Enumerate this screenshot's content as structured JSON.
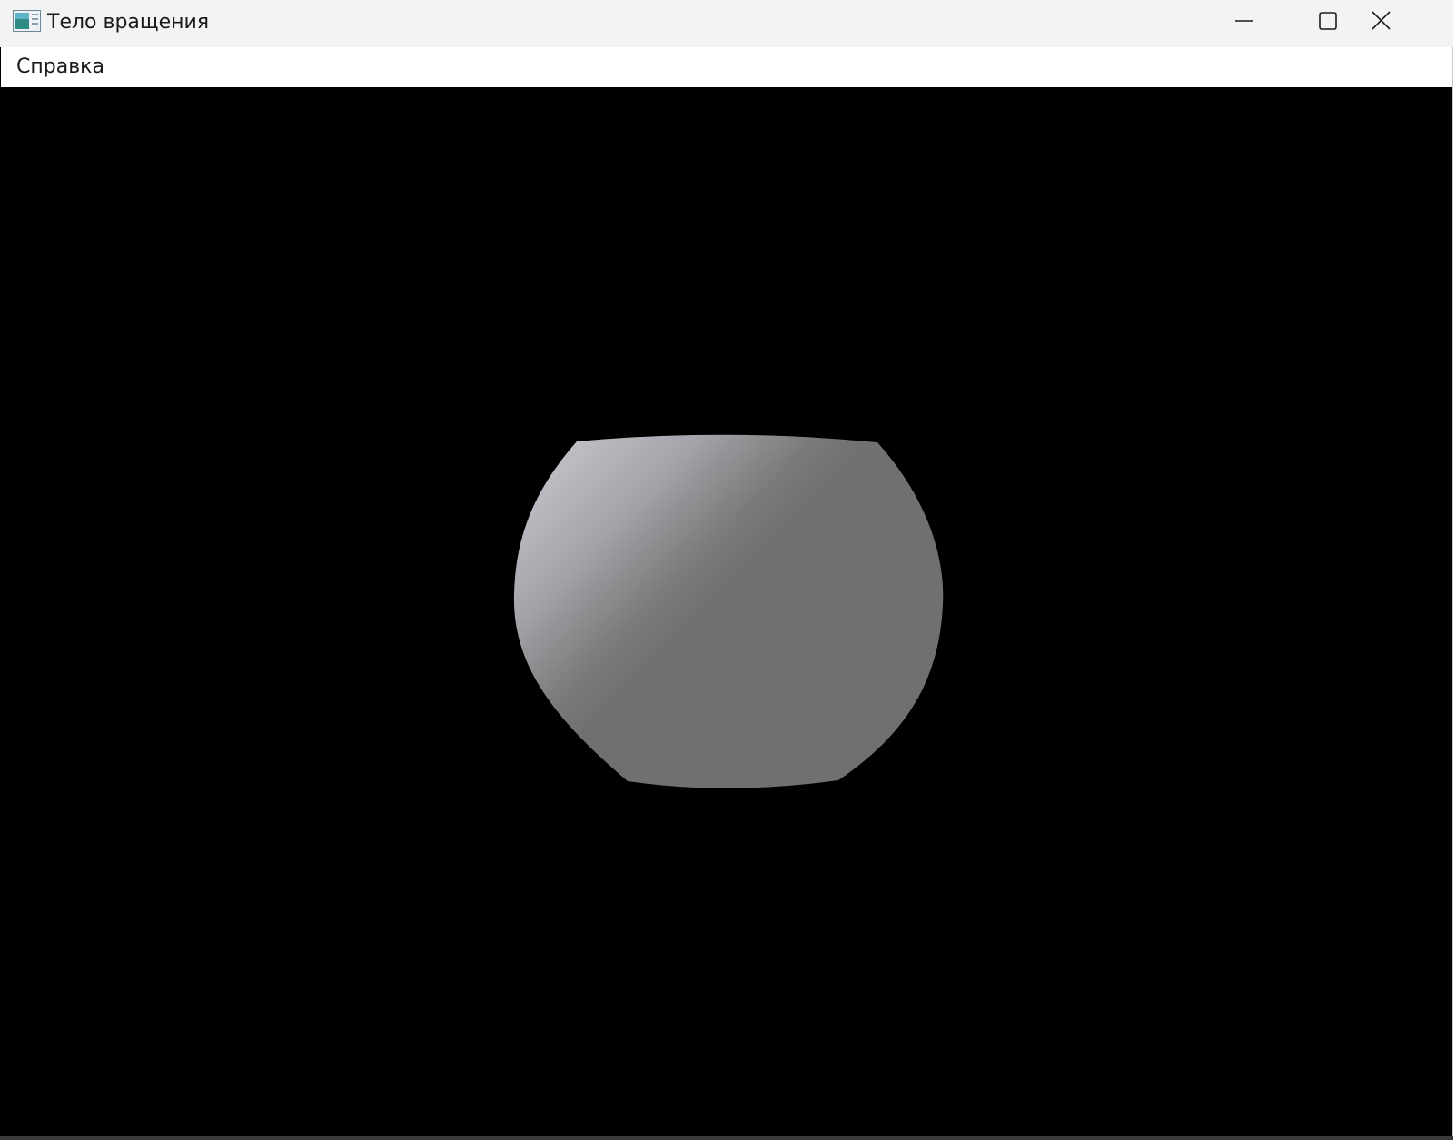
{
  "window": {
    "title": "Тело вращения",
    "icon": "app-window-icon",
    "controls": {
      "minimize_icon": "minimize-icon",
      "maximize_icon": "maximize-icon",
      "close_icon": "close-icon"
    }
  },
  "menu": {
    "items": [
      {
        "label": "Справка"
      }
    ]
  },
  "scene": {
    "background_color": "#000000",
    "object_color": "#707070",
    "highlight_color": "#c4c4cc"
  }
}
